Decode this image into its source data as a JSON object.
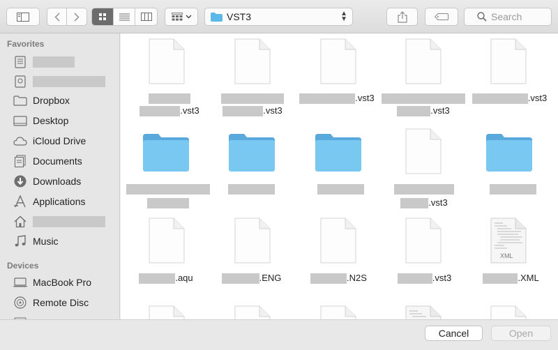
{
  "toolbar": {
    "path_folder": "VST3",
    "search_placeholder": "Search"
  },
  "sidebar": {
    "favorites_header": "Favorites",
    "devices_header": "Devices",
    "items": [
      {
        "label": "Dropbox",
        "icon": "folder-icon"
      },
      {
        "label": "Desktop",
        "icon": "desktop-icon"
      },
      {
        "label": "iCloud Drive",
        "icon": "cloud-icon"
      },
      {
        "label": "Documents",
        "icon": "documents-icon"
      },
      {
        "label": "Downloads",
        "icon": "downloads-icon"
      },
      {
        "label": "Applications",
        "icon": "applications-icon"
      },
      {
        "label": "Music",
        "icon": "music-icon"
      }
    ],
    "devices": [
      {
        "label": "MacBook Pro",
        "icon": "laptop-icon"
      },
      {
        "label": "Remote Disc",
        "icon": "disc-icon"
      }
    ]
  },
  "files": {
    "row1": [
      ".vst3",
      ".vst3",
      ".vst3",
      ".vst3",
      ".vst3"
    ],
    "row2": [
      "",
      "",
      "",
      ".vst3",
      ""
    ],
    "row3": [
      ".aqu",
      ".ENG",
      ".N2S",
      ".vst3",
      ".XML"
    ],
    "xml_icon_text": "XML"
  },
  "buttons": {
    "cancel": "Cancel",
    "open": "Open"
  },
  "colors": {
    "folder": "#5db8ea",
    "redaction": "#c9c9c9"
  }
}
